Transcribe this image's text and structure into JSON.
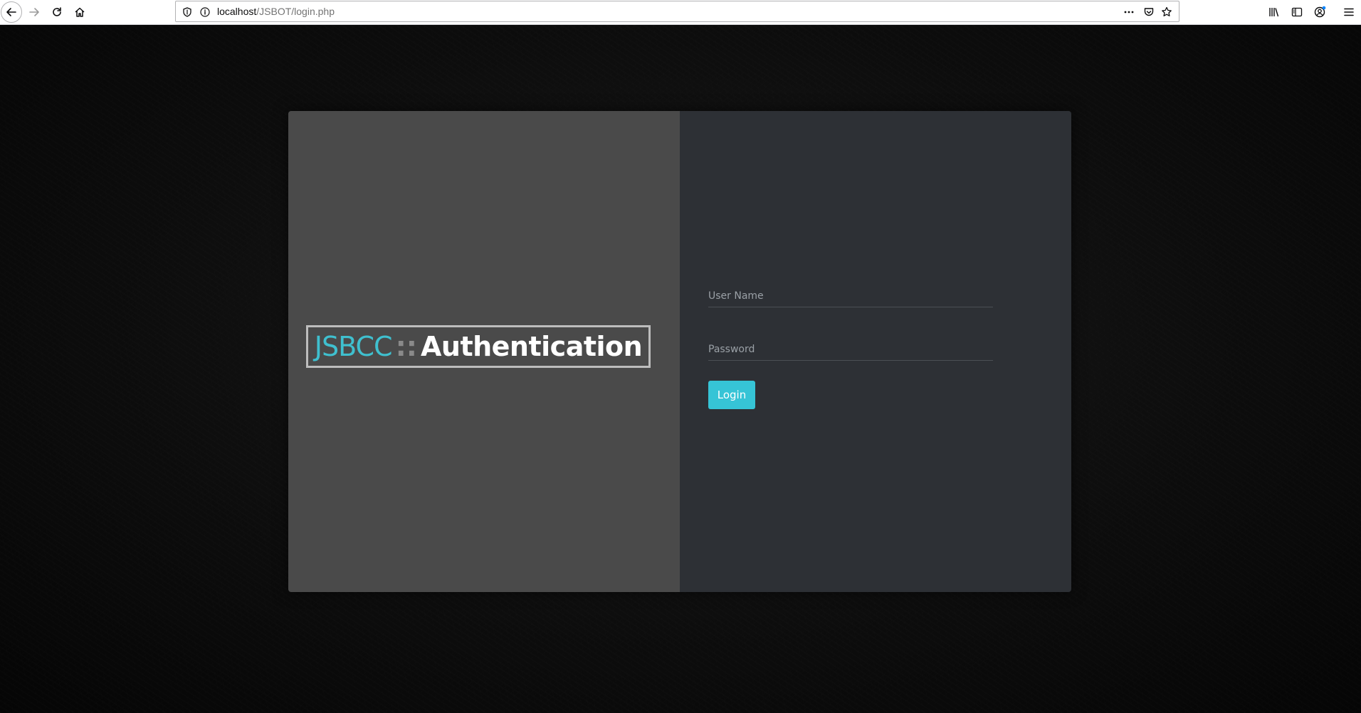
{
  "browser": {
    "url_host": "localhost",
    "url_path": "/JSBOT/login.php"
  },
  "icons": {
    "back": "back-arrow-icon",
    "forward": "forward-arrow-icon",
    "reload": "reload-icon",
    "home": "home-icon",
    "tracking": "shield-icon",
    "site_info": "info-icon",
    "page_actions": "more-dots-icon",
    "pocket": "pocket-icon",
    "bookmark": "star-icon",
    "library": "library-icon",
    "sidebar": "sidebar-icon",
    "account": "account-icon",
    "menu": "hamburger-menu-icon"
  },
  "brand": {
    "prefix": "JSBCC",
    "separator": "::",
    "title": "Authentication"
  },
  "form": {
    "username_placeholder": "User Name",
    "username_value": "",
    "password_placeholder": "Password",
    "password_value": "",
    "login_label": "Login"
  },
  "colors": {
    "accent": "#36c4d6",
    "brand_cyan": "#3fc0cf",
    "left_panel": "#4a4a4a",
    "right_panel": "#2d3035"
  }
}
